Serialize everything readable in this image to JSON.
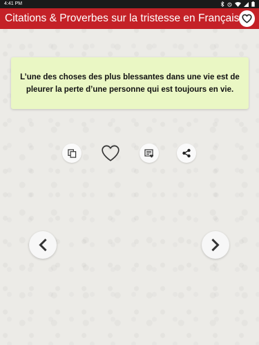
{
  "status_bar": {
    "time": "4:41 PM"
  },
  "app_bar": {
    "title": "Citations & Proverbes sur la tristesse en Français"
  },
  "quote": {
    "text": "L’une des choses des plus blessantes dans une vie est de pleurer la perte d’une personne qui est toujours en vie."
  },
  "actions": [
    {
      "name": "copy",
      "icon": "copy-icon"
    },
    {
      "name": "favorite",
      "icon": "heart-outline-icon"
    },
    {
      "name": "note",
      "icon": "note-icon"
    },
    {
      "name": "share",
      "icon": "share-icon"
    }
  ],
  "navigation": {
    "previous_icon": "chevron-left-icon",
    "next_icon": "chevron-right-icon"
  },
  "colors": {
    "app_bar": "#c42127",
    "quote_card": "#eaf7c4",
    "background": "#ecebe7"
  }
}
